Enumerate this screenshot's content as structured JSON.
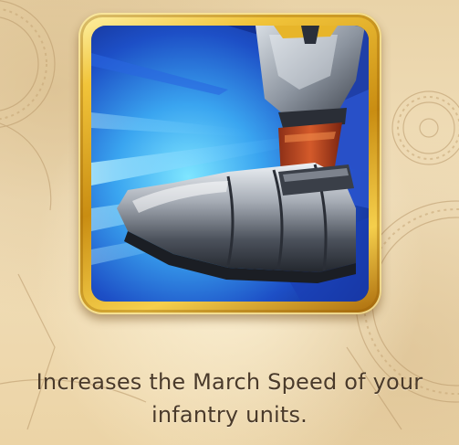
{
  "skill": {
    "icon_name": "infantry-boot-speed-icon",
    "description": "Increases the March Speed of your infantry units."
  },
  "colors": {
    "frame_gold": "#e8b82a",
    "background_parchment": "#efdcb5",
    "icon_background_blue": "#1e5fd0",
    "text": "#4a3a2a"
  }
}
